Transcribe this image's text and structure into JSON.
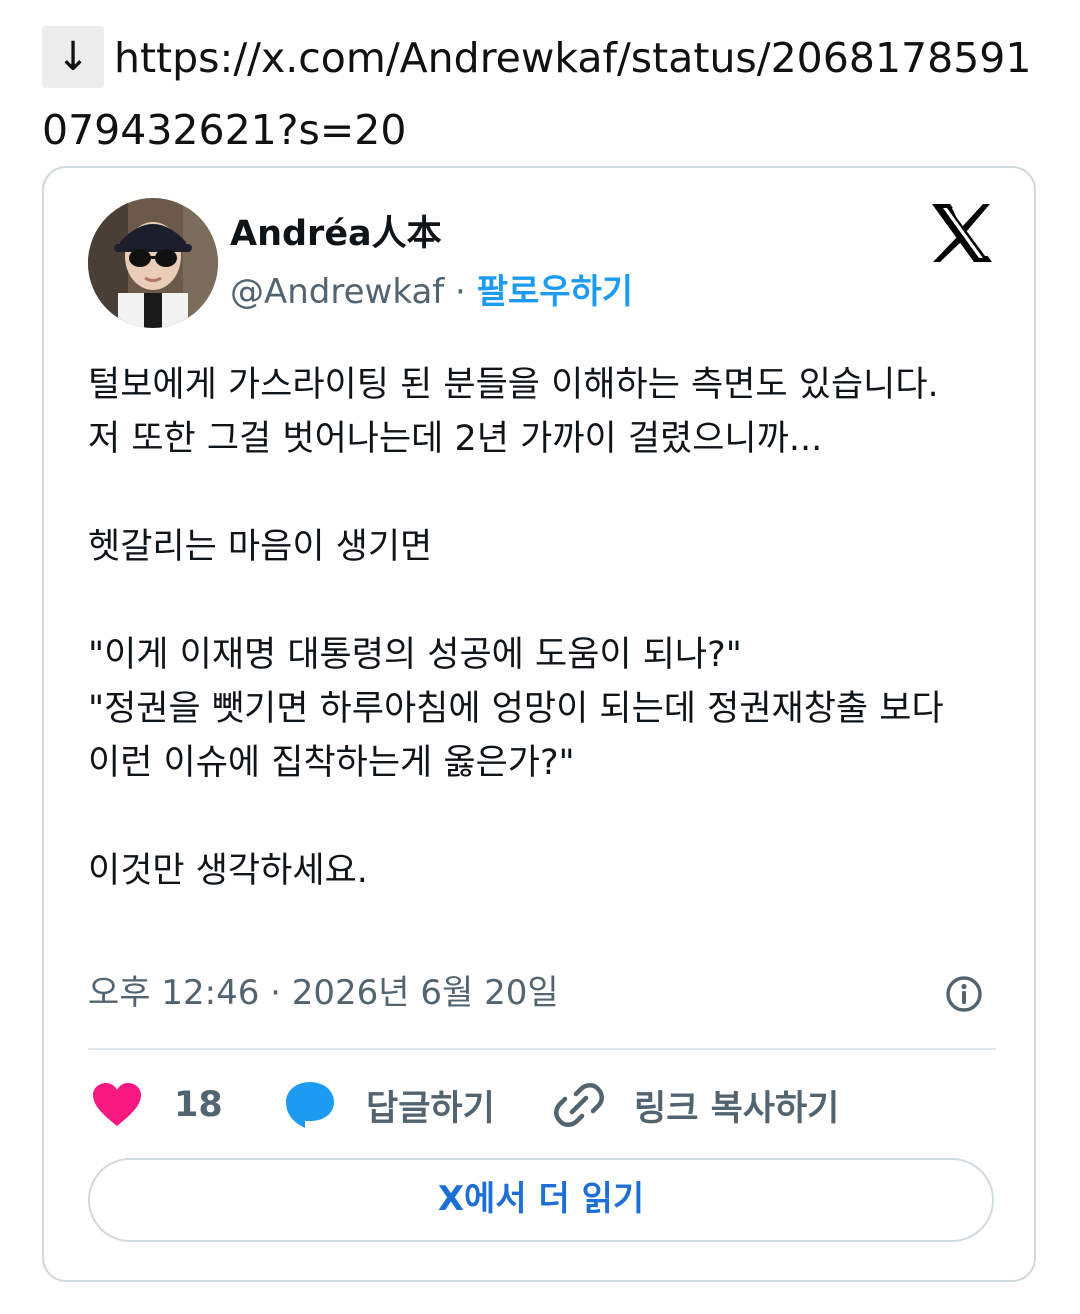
{
  "url": {
    "arrow": "↓",
    "text": "https://x.com/Andrewkaf/status/2068178591079432621?s=20"
  },
  "tweet": {
    "author_name": "Andréa人本",
    "handle": "@Andrewkaf",
    "separator": " · ",
    "follow_label": "팔로우하기",
    "text": "털보에게 가스라이팅 된 분들을 이해하는 측면도 있습니다.\n저 또한 그걸 벗어나는데 2년 가까이 걸렸으니까...\n\n헷갈리는 마음이 생기면\n\n\"이게 이재명 대통령의 성공에 도움이 되나?\"\n\"정권을 뺏기면 하루아침에 엉망이 되는데 정권재창출 보다 이런 이슈에 집착하는게 옳은가?\"\n\n이것만 생각하세요.",
    "timestamp": "오후 12:46 · 2026년 6월 20일"
  },
  "actions": {
    "like_count": "18",
    "reply_label": "답글하기",
    "copy_link_label": "링크 복사하기"
  },
  "read_more_label": "X에서 더 읽기",
  "icons": {
    "download": "arrow-down-icon",
    "platform": "x-logo-icon",
    "info": "info-icon",
    "like": "heart-icon",
    "reply": "speech-bubble-icon",
    "link": "link-icon"
  },
  "colors": {
    "accent": "#1d9bf0",
    "like": "#f91880",
    "reply": "#1d9bf0",
    "muted": "#536471",
    "border": "#cfd9de"
  }
}
